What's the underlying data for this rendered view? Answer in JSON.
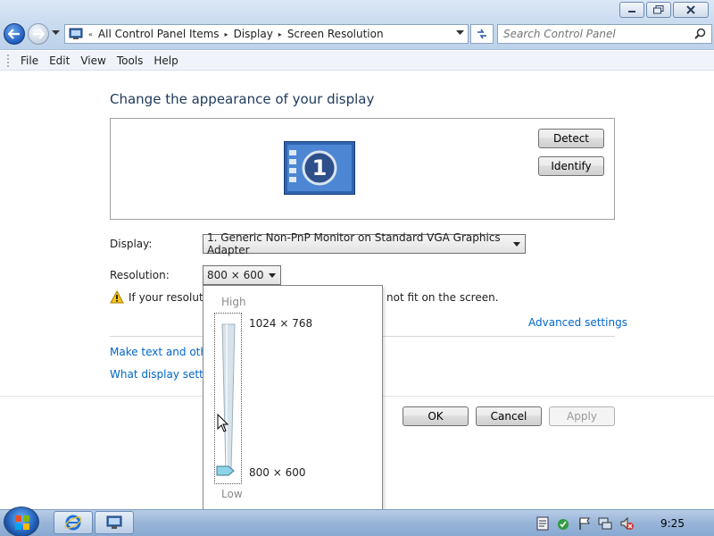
{
  "window": {
    "buttons": [
      "minimize",
      "restore",
      "close"
    ]
  },
  "address_bar": {
    "prefix": "«",
    "crumbs": [
      "All Control Panel Items",
      "Display",
      "Screen Resolution"
    ],
    "separator": "▸"
  },
  "search": {
    "placeholder": "Search Control Panel"
  },
  "menu": {
    "items": [
      "File",
      "Edit",
      "View",
      "Tools",
      "Help"
    ]
  },
  "content": {
    "heading": "Change the appearance of your display",
    "monitor_number": "1",
    "detect_label": "Detect",
    "identify_label": "Identify",
    "display_label": "Display:",
    "display_value": "1. Generic Non-PnP Monitor on Standard VGA Graphics Adapter",
    "resolution_label": "Resolution:",
    "resolution_value": "800 × 600",
    "warning_text_start": "If your resolutio",
    "warning_text_end": "not fit on the screen.",
    "advanced_link": "Advanced settings",
    "make_text_link": "Make text and other",
    "what_display_link": "What display setting"
  },
  "resolution_popup": {
    "high_label": "High",
    "low_label": "Low",
    "max_option": "1024 × 768",
    "min_option": "800 × 600",
    "slider_position": 0
  },
  "dialog_buttons": {
    "ok": "OK",
    "cancel": "Cancel",
    "apply": "Apply"
  },
  "taskbar": {
    "pinned": [
      "internet-explorer",
      "display-settings"
    ],
    "tray_icons": [
      "action-center",
      "flag",
      "network",
      "volume-muted"
    ],
    "clock": "9:25"
  },
  "colors": {
    "accent": "#1e395b",
    "link": "#0066cc"
  }
}
